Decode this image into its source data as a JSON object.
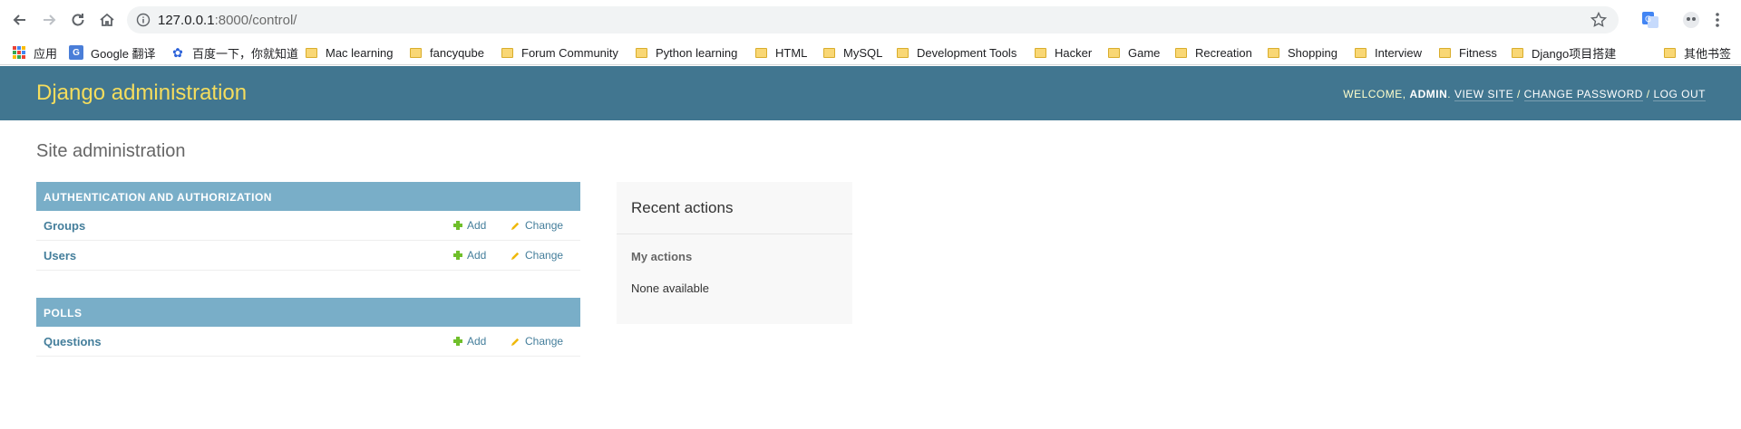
{
  "browser": {
    "url_host": "127.0.0.1",
    "url_rest": ":8000/control/",
    "bookmarks": [
      {
        "label": "应用",
        "icon": "apps-icon"
      },
      {
        "label": "Google 翻译",
        "icon": "google-translate-icon"
      },
      {
        "label": "百度一下，你就知道",
        "icon": "baidu-icon"
      },
      {
        "label": "Mac learning",
        "icon": "folder-icon"
      },
      {
        "label": "fancyqube",
        "icon": "folder-icon"
      },
      {
        "label": "Forum Community",
        "icon": "folder-icon"
      },
      {
        "label": "Python learning",
        "icon": "folder-icon"
      },
      {
        "label": "HTML",
        "icon": "folder-icon"
      },
      {
        "label": "MySQL",
        "icon": "folder-icon"
      },
      {
        "label": "Development Tools",
        "icon": "folder-icon"
      },
      {
        "label": "Hacker",
        "icon": "folder-icon"
      },
      {
        "label": "Game",
        "icon": "folder-icon"
      },
      {
        "label": "Recreation",
        "icon": "folder-icon"
      },
      {
        "label": "Shopping",
        "icon": "folder-icon"
      },
      {
        "label": "Interview",
        "icon": "folder-icon"
      },
      {
        "label": "Fitness",
        "icon": "folder-icon"
      },
      {
        "label": "Django项目搭建",
        "icon": "folder-icon"
      },
      {
        "label": "其他书签",
        "icon": "folder-icon"
      }
    ]
  },
  "header": {
    "brand": "Django administration",
    "welcome": "Welcome,",
    "user": "admin",
    "view_site": "View site",
    "change_password": "Change password",
    "log_out": "Log out",
    "separator": "/"
  },
  "content": {
    "title": "Site administration",
    "modules": [
      {
        "caption": "Authentication and Authorization",
        "rows": [
          {
            "name": "Groups",
            "add": "Add",
            "change": "Change"
          },
          {
            "name": "Users",
            "add": "Add",
            "change": "Change"
          }
        ]
      },
      {
        "caption": "Polls",
        "rows": [
          {
            "name": "Questions",
            "add": "Add",
            "change": "Change"
          }
        ]
      }
    ]
  },
  "recent_actions": {
    "title": "Recent actions",
    "subtitle": "My actions",
    "empty": "None available"
  },
  "colors": {
    "header_bg": "#417690",
    "brand": "#f5dd5d",
    "module_caption": "#79aec8",
    "link": "#447e9b",
    "add_icon": "#70bf2b",
    "change_icon": "#efb80b"
  }
}
